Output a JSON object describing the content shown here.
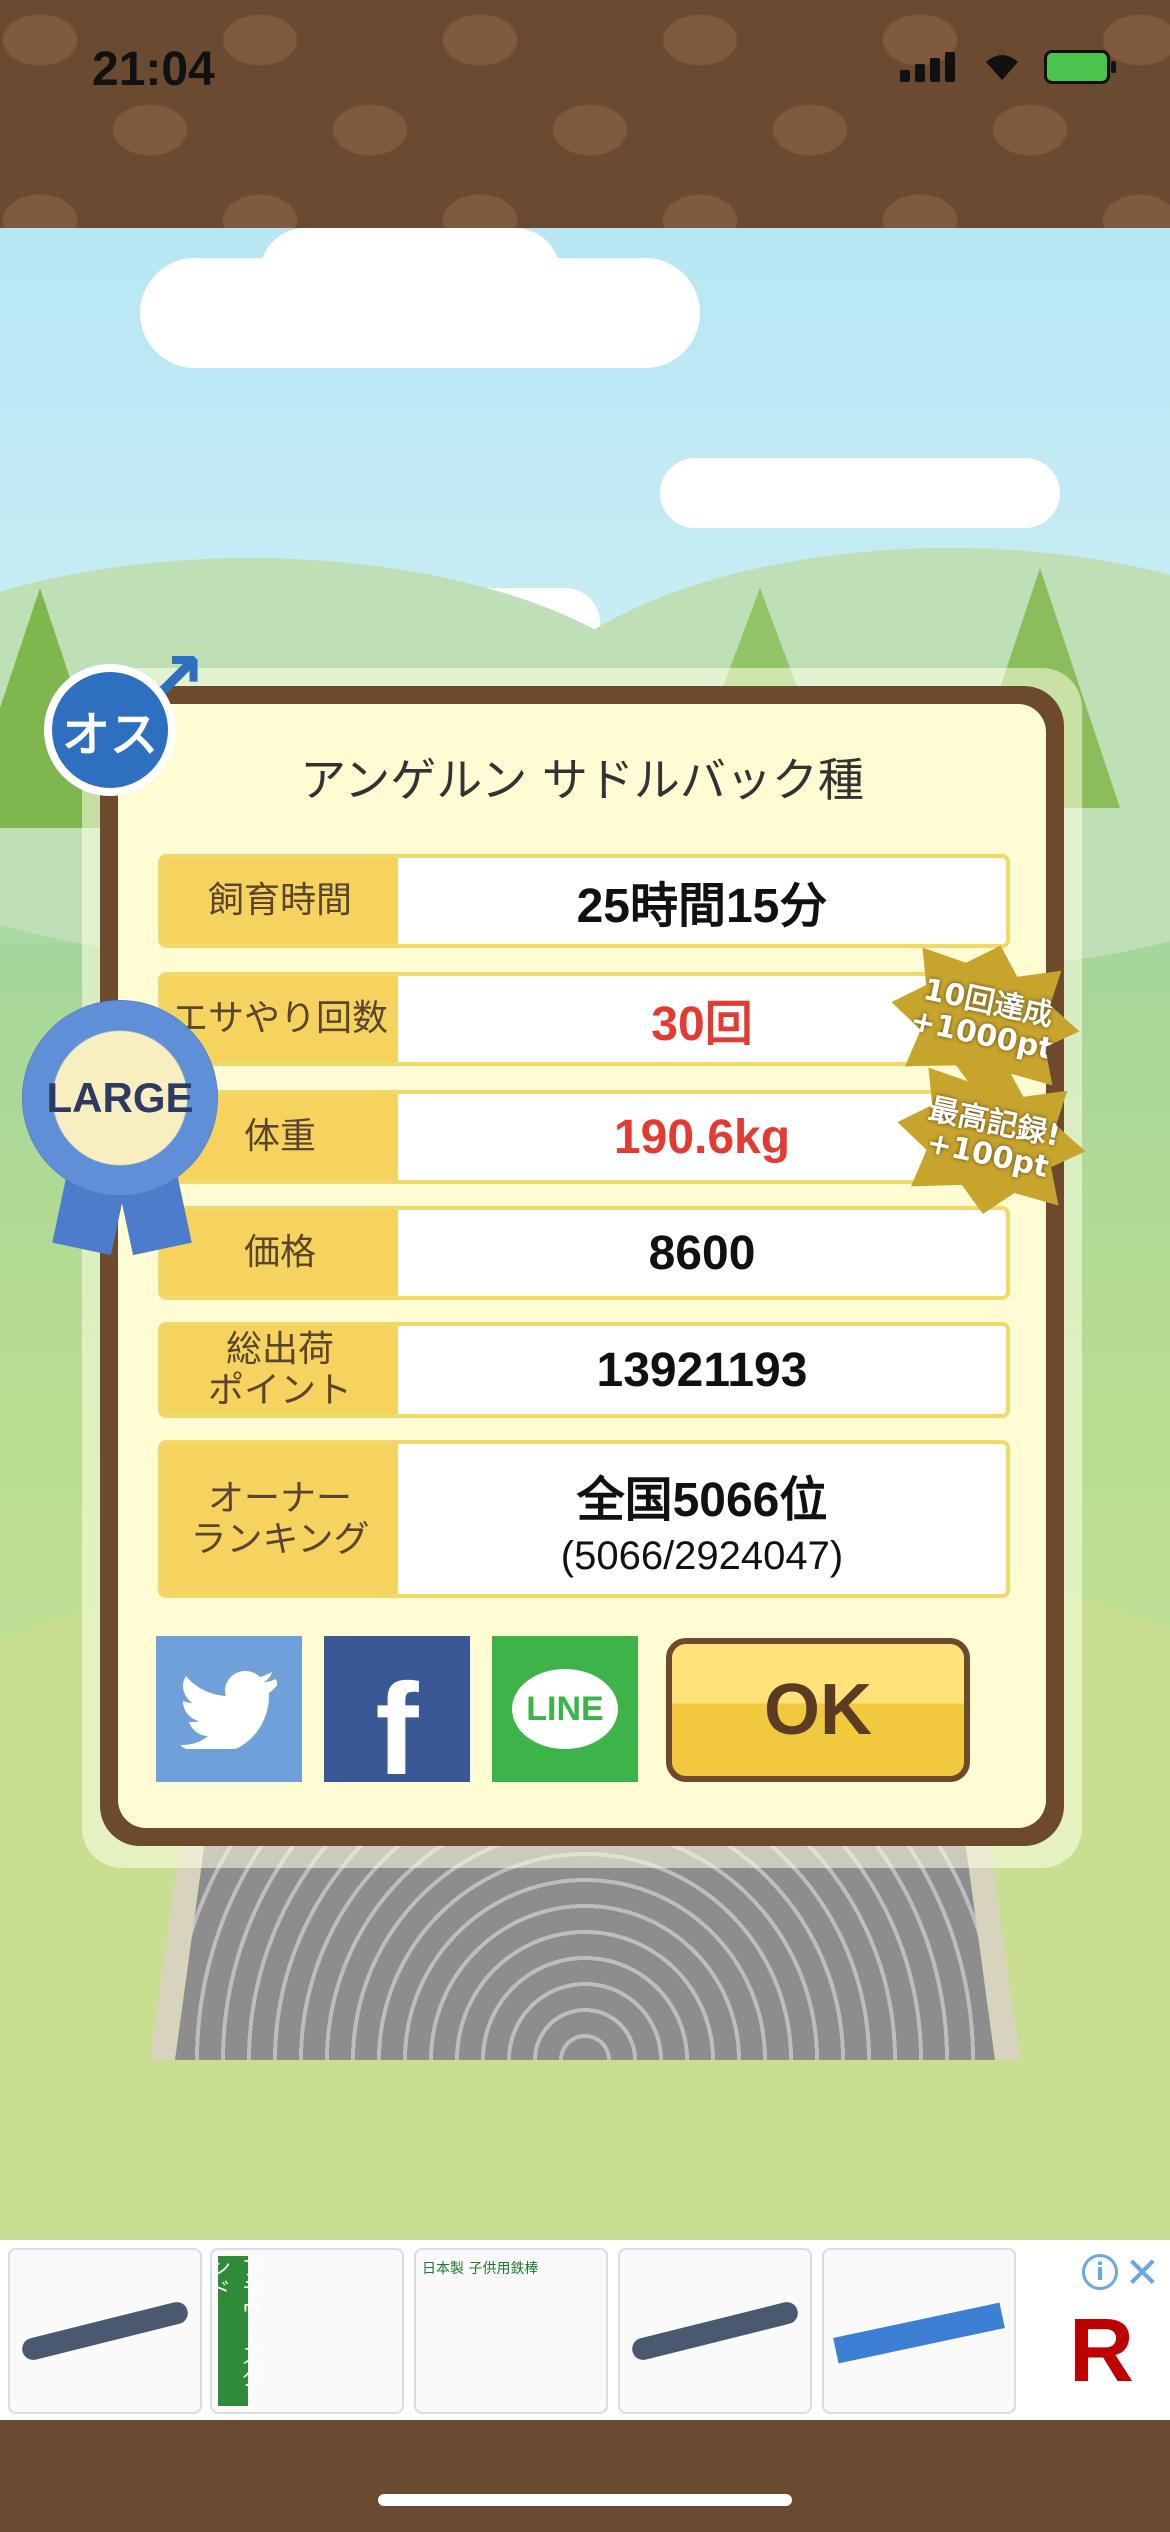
{
  "status_bar": {
    "time": "21:04"
  },
  "badges": {
    "gender": "オス",
    "size": "LARGE"
  },
  "dialog": {
    "title": "アンゲルン サドルバック種",
    "rows": [
      {
        "label": "飼育時間",
        "value": "25時間15分",
        "highlight": false
      },
      {
        "label": "エサやり回数",
        "value": "30回",
        "highlight": true
      },
      {
        "label": "体重",
        "value": "190.6kg",
        "highlight": true
      },
      {
        "label": "価格",
        "value": "8600",
        "highlight": false
      },
      {
        "label_lines": [
          "総出荷",
          "ポイント"
        ],
        "value": "13921193",
        "highlight": false
      },
      {
        "label_lines": [
          "オーナー",
          "ランキング"
        ],
        "value": "全国5066位",
        "sub": "(5066/2924047)",
        "highlight": false
      }
    ],
    "ok_label": "OK",
    "share": {
      "line_label": "LINE",
      "facebook_label": "f"
    }
  },
  "achievements": [
    {
      "line1": "10回達成",
      "line2": "+1000pt"
    },
    {
      "line1": "最高記録!",
      "line2": "+100pt"
    }
  ],
  "ad": {
    "flower_stand_text": "フラワースタンド",
    "product_text": "日本製 子供用鉄棒",
    "brand": "R"
  },
  "colors": {
    "accent": "#f6d35e",
    "frame": "#6e4a2d",
    "highlight_value": "#e33b32",
    "ok_button": "#f0c93e"
  }
}
